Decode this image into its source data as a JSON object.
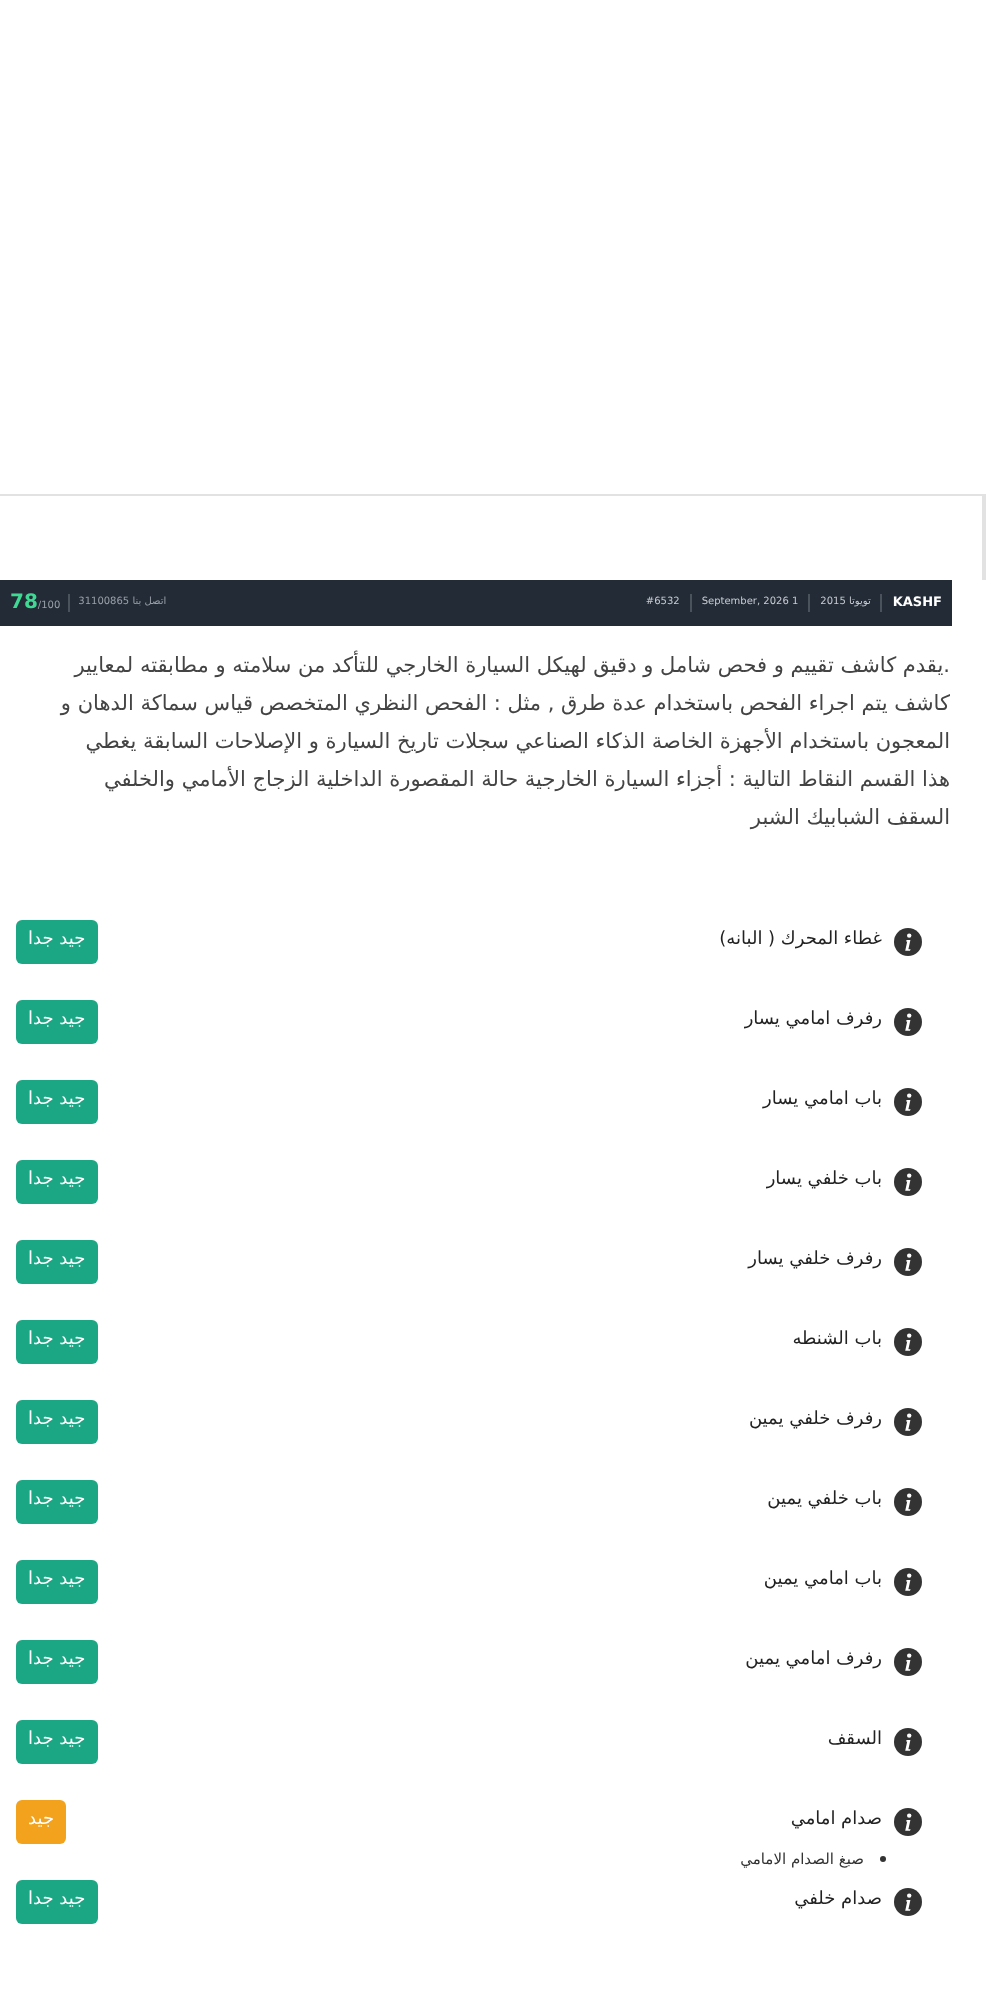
{
  "header": {
    "brand": "KASHF",
    "car": "تويوتا 2015",
    "date": "September, 2026 1",
    "report_no": "#6532",
    "phone": "اتصل بنا 31100865",
    "score": "78",
    "score_max": "/100"
  },
  "description": ".يقدم كاشف تقييم و فحص شامل و دقيق لهيكل السيارة الخارجي للتأكد من سلامته و مطابقته لمعايير كاشف يتم اجراء الفحص باستخدام عدة طرق , مثل : الفحص النظري المتخصص قياس سماكة الدهان و المعجون باستخدام الأجهزة الخاصة الذكاء الصناعي سجلات تاريخ السيارة و الإصلاحات السابقة يغطي هذا القسم النقاط التالية : أجزاء السيارة الخارجية حالة المقصورة الداخلية الزجاج الأمامي والخلفي السقف الشبابيك الشبر",
  "items": [
    {
      "label": "غطاء المحرك ( البانه)",
      "rating": "جيد جدا",
      "kind": "very_good"
    },
    {
      "label": "رفرف امامي يسار",
      "rating": "جيد جدا",
      "kind": "very_good"
    },
    {
      "label": "باب امامي يسار",
      "rating": "جيد جدا",
      "kind": "very_good"
    },
    {
      "label": "باب خلفي يسار",
      "rating": "جيد جدا",
      "kind": "very_good"
    },
    {
      "label": "رفرف خلفي يسار",
      "rating": "جيد جدا",
      "kind": "very_good"
    },
    {
      "label": "باب الشنطه",
      "rating": "جيد جدا",
      "kind": "very_good"
    },
    {
      "label": "رفرف خلفي يمين",
      "rating": "جيد جدا",
      "kind": "very_good"
    },
    {
      "label": "باب خلفي يمين",
      "rating": "جيد جدا",
      "kind": "very_good"
    },
    {
      "label": "باب امامي يمين",
      "rating": "جيد جدا",
      "kind": "very_good"
    },
    {
      "label": "رفرف امامي يمين",
      "rating": "جيد جدا",
      "kind": "very_good"
    },
    {
      "label": "السقف",
      "rating": "جيد جدا",
      "kind": "very_good"
    },
    {
      "label": "صدام امامي",
      "rating": "جيد",
      "kind": "good",
      "notes": [
        "صبغ الصدام الامامي"
      ]
    },
    {
      "label": "صدام خلفي",
      "rating": "جيد جدا",
      "kind": "very_good"
    }
  ]
}
